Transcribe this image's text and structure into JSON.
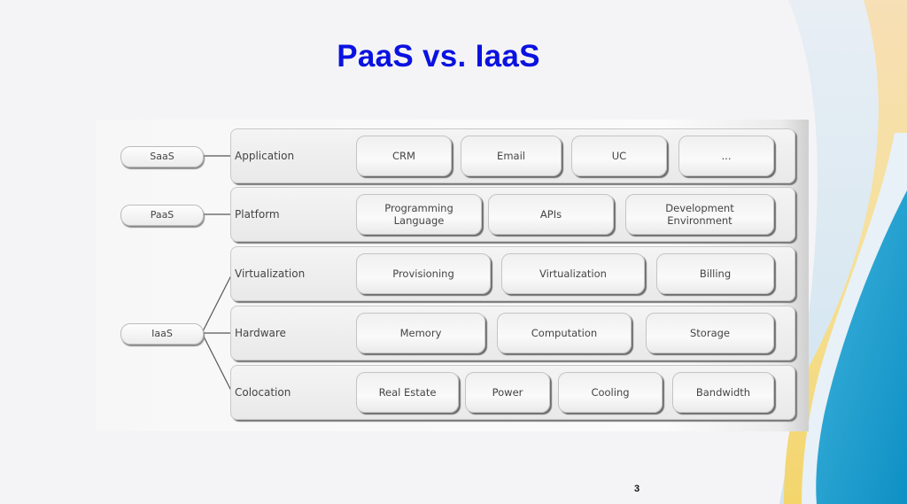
{
  "slide": {
    "title": "PaaS vs. IaaS",
    "page_number": "3"
  },
  "diagram": {
    "service_models": [
      {
        "label": "SaaS",
        "connects_to": [
          "Application"
        ]
      },
      {
        "label": "PaaS",
        "connects_to": [
          "Platform"
        ]
      },
      {
        "label": "IaaS",
        "connects_to": [
          "Virtualization",
          "Hardware",
          "Colocation"
        ]
      }
    ],
    "layers": [
      {
        "label": "Application",
        "items": [
          "CRM",
          "Email",
          "UC",
          "..."
        ]
      },
      {
        "label": "Platform",
        "items": [
          "Programming\nLanguage",
          "APIs",
          "Development\nEnvironment"
        ]
      },
      {
        "label": "Virtualization",
        "items": [
          "Provisioning",
          "Virtualization",
          "Billing"
        ]
      },
      {
        "label": "Hardware",
        "items": [
          "Memory",
          "Computation",
          "Storage"
        ]
      },
      {
        "label": "Colocation",
        "items": [
          "Real Estate",
          "Power",
          "Cooling",
          "Bandwidth"
        ]
      }
    ]
  },
  "theme": {
    "title_color": "#0a12e0",
    "accent_blue": "#1a9fd0",
    "accent_yellow": "#f5d77a"
  }
}
